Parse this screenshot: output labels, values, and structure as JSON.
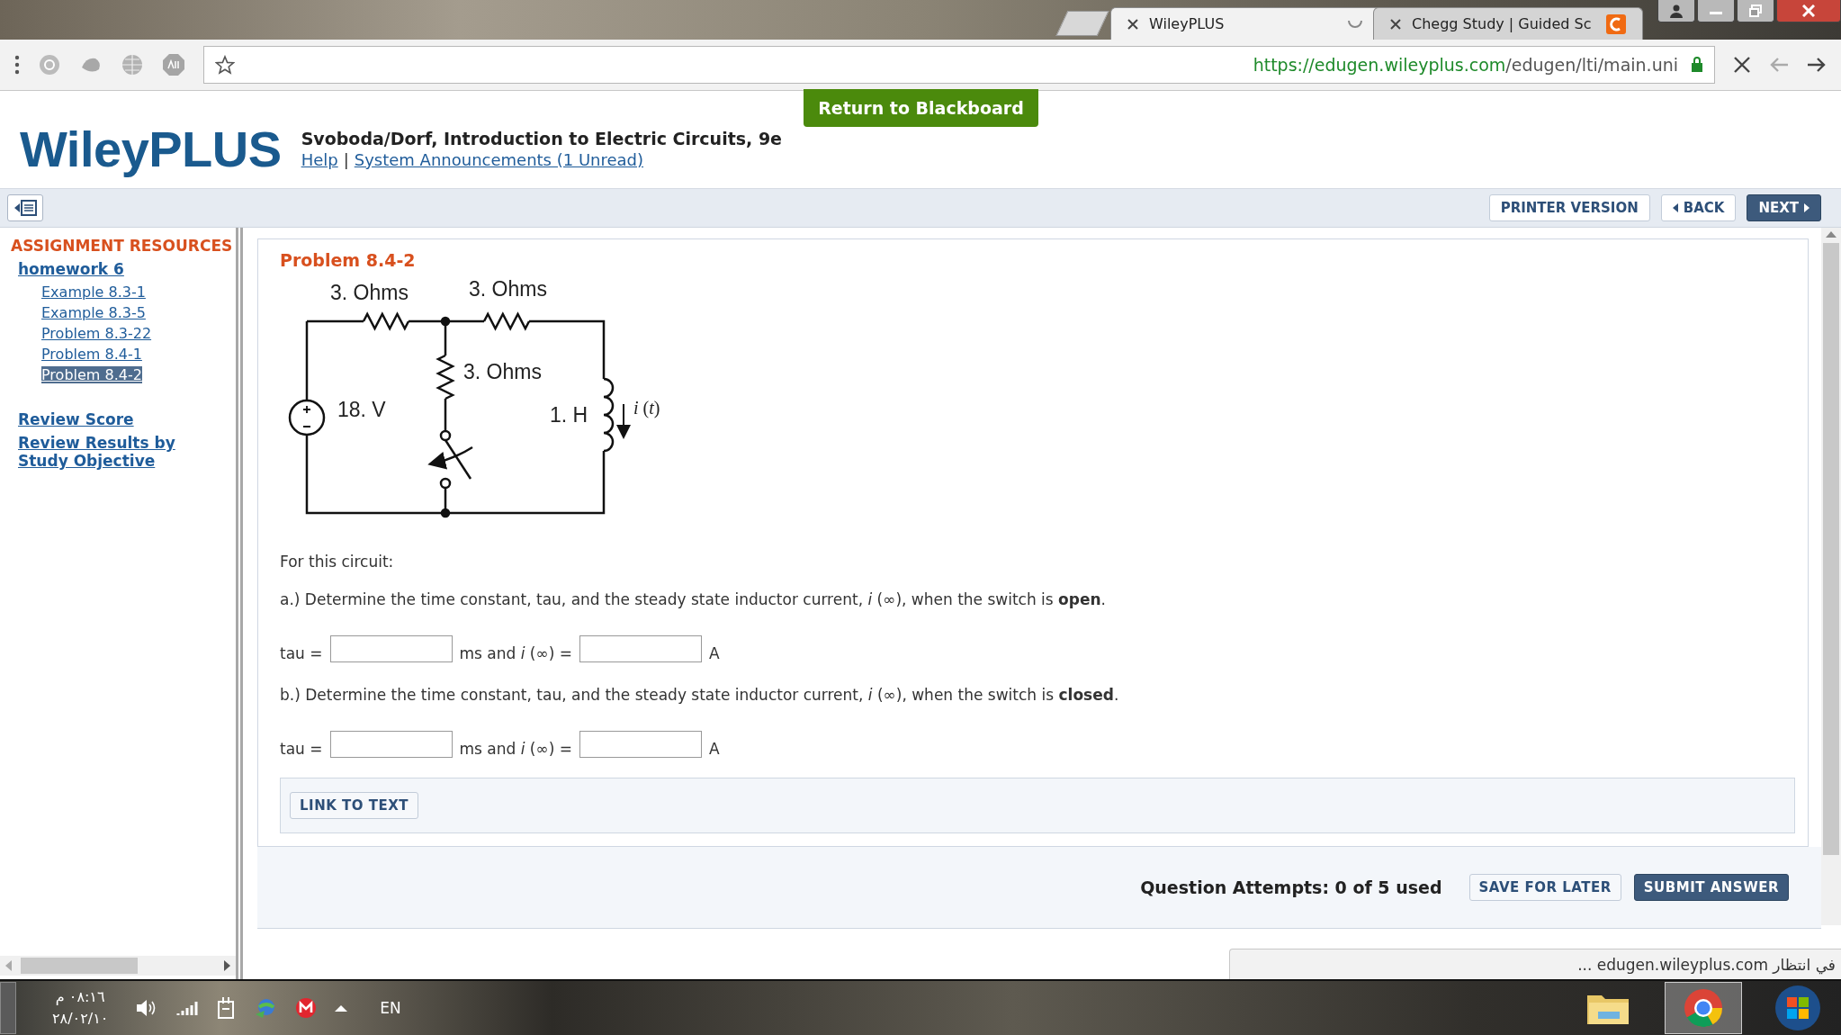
{
  "browser": {
    "tabs": [
      {
        "title": "WileyPLUS",
        "selected": true,
        "loading": true
      },
      {
        "title": "Chegg Study | Guided Sc",
        "selected": false,
        "loading": false
      }
    ],
    "url_host": "https://edugen.wileyplus.com",
    "url_path": "/edugen/lti/main.uni",
    "status": "في انتظار edugen.wileyplus.com ..."
  },
  "return_button": "Return to Blackboard",
  "header": {
    "logo": "WileyPLUS",
    "course": "Svoboda/Dorf, Introduction to Electric Circuits, 9e",
    "links": [
      "Help",
      "System Announcements (1 Unread)"
    ],
    "separator": "|"
  },
  "toolbar": {
    "buttons": [
      {
        "label": "PRINTER VERSION",
        "kind": "plain"
      },
      {
        "label": "BACK",
        "kind": "back"
      },
      {
        "label": "NEXT",
        "kind": "next"
      }
    ]
  },
  "sidebar": {
    "heading": "ASSIGNMENT RESOURCES",
    "items": [
      {
        "label": "homework 6",
        "selected": false,
        "children": [
          {
            "label": "Example 8.3-1",
            "selected": false
          },
          {
            "label": "Example 8.3-5",
            "selected": false
          },
          {
            "label": "Problem 8.3-22",
            "selected": false
          },
          {
            "label": "Problem 8.4-1",
            "selected": false
          },
          {
            "label": "Problem 8.4-2",
            "selected": true
          }
        ]
      }
    ],
    "links": [
      "Review Score",
      "Review Results by Study Objective"
    ]
  },
  "problem": {
    "title": "Problem 8.4-2",
    "circuit_labels": [
      "3. Ohms",
      "3. Ohms",
      "3. Ohms",
      "18. V",
      "1. H",
      "*i* (*t*)"
    ],
    "intro": "For this circuit:",
    "parts": [
      {
        "question": "a.) Determine the time constant, tau, and the steady state inductor current, *i* (∞), when the switch is **open**.",
        "label_1": "tau =",
        "label_2": "ms and *i* (∞) =",
        "unit": "A"
      },
      {
        "question": "b.) Determine the time constant, tau, and the steady state inductor current, *i* (∞), when the switch is **closed**.",
        "label_1": "tau =",
        "label_2": "ms and *i* (∞) =",
        "unit": "A"
      }
    ],
    "link_button": "LINK TO TEXT"
  },
  "footer": {
    "attempts": "Question Attempts: 0 of 5 used",
    "buttons": [
      {
        "label": "SAVE FOR LATER",
        "kind": "secondary"
      },
      {
        "label": "SUBMIT ANSWER",
        "kind": "primary"
      }
    ]
  },
  "taskbar": {
    "time": "٠٨:١٦ م",
    "date": "٢٨/٠٢/١٠",
    "language": "EN"
  }
}
